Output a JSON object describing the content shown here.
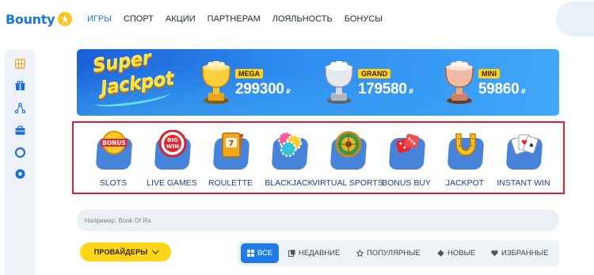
{
  "header": {
    "logo_text": "Bounty",
    "nav": [
      {
        "label": "ИГРЫ",
        "active": true
      },
      {
        "label": "СПОРТ",
        "active": false
      },
      {
        "label": "АКЦИИ",
        "active": false
      },
      {
        "label": "ПАРТНЕРАМ",
        "active": false
      },
      {
        "label": "ЛОЯЛЬНОСТЬ",
        "active": false
      },
      {
        "label": "БОНУСЫ",
        "active": false
      }
    ]
  },
  "sidebar": {
    "icons": [
      "slots-grid-icon",
      "gift-icon",
      "network-icon",
      "briefcase-icon",
      "lifebuoy-icon",
      "football-icon"
    ]
  },
  "banner": {
    "logo_line1": "Super",
    "logo_line2": "Jackpot",
    "jackpots": [
      {
        "label": "MEGA",
        "value": "299300",
        "currency": "₽",
        "trophy": "gold"
      },
      {
        "label": "GRAND",
        "value": "179580",
        "currency": "₽",
        "trophy": "silver"
      },
      {
        "label": "MINI",
        "value": "59860",
        "currency": "₽",
        "trophy": "bronze"
      }
    ]
  },
  "categories": [
    {
      "label": "SLOTS",
      "icon": "bonus-sign-icon",
      "badge": "BONUS"
    },
    {
      "label": "LIVE GAMES",
      "icon": "big-win-icon",
      "badge1": "BIG",
      "badge2": "WIN"
    },
    {
      "label": "ROULETTE",
      "icon": "slot-machine-icon"
    },
    {
      "label": "BLACKJACK",
      "icon": "chips-icon"
    },
    {
      "label": "VIRTUAL SPORTS",
      "icon": "roulette-wheel-icon"
    },
    {
      "label": "BONUS BUY",
      "icon": "dice-icon"
    },
    {
      "label": "JACKPOT",
      "icon": "horseshoe-icon"
    },
    {
      "label": "INSTANT WIN",
      "icon": "playing-cards-icon"
    }
  ],
  "search": {
    "placeholder": "Например: Book Of Ra"
  },
  "providers": {
    "label": "ПРОВАЙДЕРЫ"
  },
  "filters": [
    {
      "label": "ВСЕ",
      "icon": "grid-icon",
      "active": true
    },
    {
      "label": "НЕДАВНИЕ",
      "icon": "recent-icon",
      "active": false
    },
    {
      "label": "ПОПУЛЯРНЫЕ",
      "icon": "star-icon",
      "active": false
    },
    {
      "label": "НОВЫЕ",
      "icon": "diamond-icon",
      "active": false
    },
    {
      "label": "ИЗБРАННЫЕ",
      "icon": "heart-icon",
      "active": false
    }
  ],
  "colors": {
    "brand_blue": "#1677e5",
    "accent_yellow": "#ffd517",
    "highlight_red": "#dc1f2e",
    "category_text": "#1d3f8f"
  }
}
